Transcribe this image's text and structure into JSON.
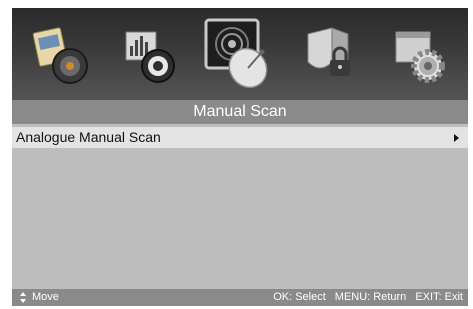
{
  "menu_icons": [
    {
      "name": "picture-sound-icon",
      "selected": false
    },
    {
      "name": "sound-setup-icon",
      "selected": false
    },
    {
      "name": "channel-scan-icon",
      "selected": true
    },
    {
      "name": "lock-icon",
      "selected": false
    },
    {
      "name": "setup-gear-icon",
      "selected": false
    }
  ],
  "title": "Manual Scan",
  "menu": {
    "items": [
      {
        "label": "Analogue Manual Scan",
        "has_submenu": true,
        "selected": true
      }
    ]
  },
  "status": {
    "move": "Move",
    "select": "OK: Select",
    "return": "MENU: Return",
    "exit": "EXIT: Exit"
  },
  "colors": {
    "panel": "#bdbdbd",
    "title_bar": "#8a8a8a",
    "highlight_row": "#e3e3e3",
    "text_light": "#ffffff",
    "text_dark": "#111111"
  }
}
